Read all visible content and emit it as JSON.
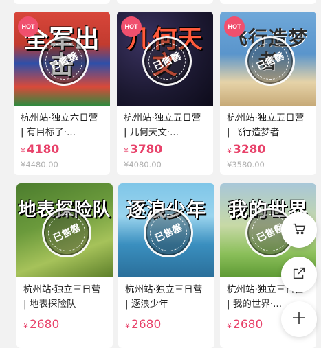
{
  "badge": "HOT",
  "sold_stamp": "已售罄",
  "currency": "¥",
  "cards": [
    {
      "title": "杭州站·独立六日营 | 有目标了·...",
      "price": "4180",
      "original_price": "¥4480.00",
      "thumb_text": "全军出击",
      "hot": true
    },
    {
      "title": "杭州站·独立五日营 | 几何天文·...",
      "price": "3780",
      "original_price": "¥4080.00",
      "thumb_text": "几何天文",
      "hot": true
    },
    {
      "title": "杭州站·独立五日营 | 飞行造梦者",
      "price": "3280",
      "original_price": "¥3580.00",
      "thumb_text": "飞行造梦者",
      "hot": true
    },
    {
      "title": "杭州站·独立三日营 | 地表探险队",
      "price": "2680",
      "original_price": "",
      "thumb_text": "地表探险队",
      "hot": false
    },
    {
      "title": "杭州站·独立三日营 | 逐浪少年",
      "price": "2680",
      "original_price": "",
      "thumb_text": "逐浪少年",
      "hot": false
    },
    {
      "title": "杭州站·独立三日营 | 我的世界·...",
      "price": "2680",
      "original_price": "",
      "thumb_text": "我的世界",
      "hot": false
    }
  ],
  "floating_buttons": [
    {
      "icon": "cart-icon"
    },
    {
      "icon": "share-icon"
    },
    {
      "icon": "plus-icon"
    }
  ]
}
